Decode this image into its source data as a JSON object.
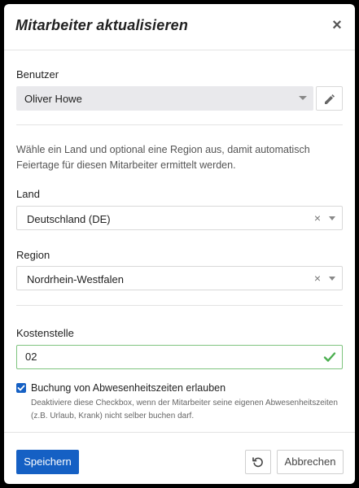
{
  "modal": {
    "title": "Mitarbeiter aktualisieren",
    "close_icon": "close-icon"
  },
  "user": {
    "label": "Benutzer",
    "value": "Oliver Howe",
    "edit_icon": "pencil-icon"
  },
  "hint": "Wähle ein Land und optional eine Region aus, damit automatisch Feiertage für diesen Mitarbeiter ermittelt werden.",
  "country": {
    "label": "Land",
    "value": "Deutschland (DE)",
    "clear_glyph": "×"
  },
  "region": {
    "label": "Region",
    "value": "Nordrhein-Westfalen",
    "clear_glyph": "×"
  },
  "cost_center": {
    "label": "Kostenstelle",
    "value": "02",
    "valid_icon": "checkmark-icon",
    "valid_color": "#4caf50"
  },
  "absence_booking": {
    "checked": true,
    "label": "Buchung von Abwesenheitszeiten erlauben",
    "description": "Deaktiviere diese Checkbox, wenn der Mitarbeiter seine eigenen Abwesenheitszeiten (z.B. Urlaub, Krank) nicht selber buchen darf."
  },
  "footer": {
    "save_label": "Speichern",
    "reset_icon": "undo-icon",
    "cancel_label": "Abbrechen"
  },
  "colors": {
    "primary": "#1560c4",
    "valid_border": "#7fc47f"
  }
}
